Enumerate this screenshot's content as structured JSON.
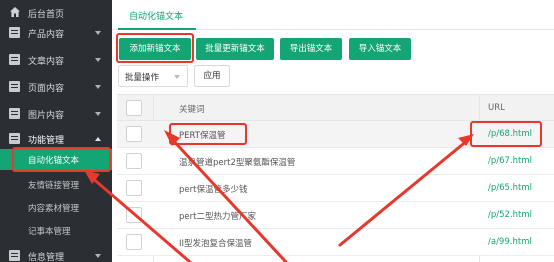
{
  "sidebar": {
    "items": [
      {
        "label": "后台首页",
        "icon": "home-icon"
      },
      {
        "label": "产品内容",
        "icon": "list-icon"
      },
      {
        "label": "文章内容",
        "icon": "document-icon"
      },
      {
        "label": "页面内容",
        "icon": "page-icon"
      },
      {
        "label": "图片内容",
        "icon": "image-icon"
      },
      {
        "label": "功能管理",
        "icon": "function-icon"
      },
      {
        "label": "信息管理",
        "icon": "message-icon"
      }
    ],
    "sub_items": [
      {
        "label": "自动化锚文本",
        "active": true
      },
      {
        "label": "友情链接管理"
      },
      {
        "label": "内容素材管理"
      },
      {
        "label": "记事本管理"
      }
    ]
  },
  "tab": {
    "label": "自动化锚文本"
  },
  "toolbar": {
    "add": "添加新锚文本",
    "batch_update": "批量更新锚文本",
    "export": "导出锚文本",
    "import": "导入锚文本"
  },
  "batch": {
    "select": "批量操作",
    "apply": "应用"
  },
  "table": {
    "headers": {
      "keyword": "关键词",
      "url": "URL"
    },
    "rows": [
      {
        "keyword": "PERT保温管",
        "url": "/p/68.html"
      },
      {
        "keyword": "温泉管道pert2型聚氨酯保温管",
        "url": "/p/67.html"
      },
      {
        "keyword": "pert保温管多少钱",
        "url": "/p/65.html"
      },
      {
        "keyword": "pert二型热力管厂家",
        "url": "/p/52.html"
      },
      {
        "keyword": "II型发泡复合保温管",
        "url": "/a/99.html"
      }
    ]
  },
  "colors": {
    "accent": "#13a574",
    "sidebar_bg": "#2b2e33",
    "annotation": "#e8372b"
  }
}
